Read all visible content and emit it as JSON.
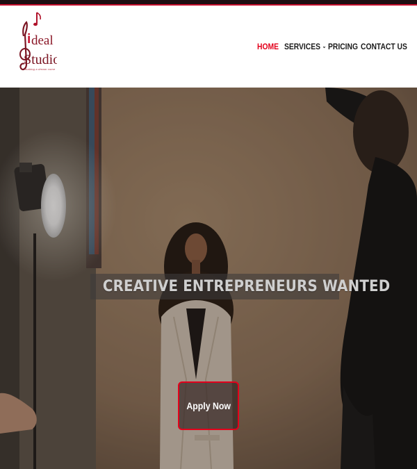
{
  "brand": {
    "logo_text_i": "i",
    "logo_text_deal": "deal",
    "logo_text_studio": "Studio",
    "tagline": "making a dream come"
  },
  "nav": {
    "items": [
      {
        "label": "HOME",
        "active": true
      },
      {
        "label": "SERVICES",
        "has_dropdown": true
      },
      {
        "label": "PRICING"
      },
      {
        "label": "CONTACT US"
      }
    ]
  },
  "hero": {
    "headline": "CREATIVE ENTREPRENEURS WANTED",
    "cta_label": "Apply Now"
  },
  "colors": {
    "accent": "#e3001b",
    "nav_text": "#1b1b1b",
    "top_stripe": "#1e0f12"
  }
}
